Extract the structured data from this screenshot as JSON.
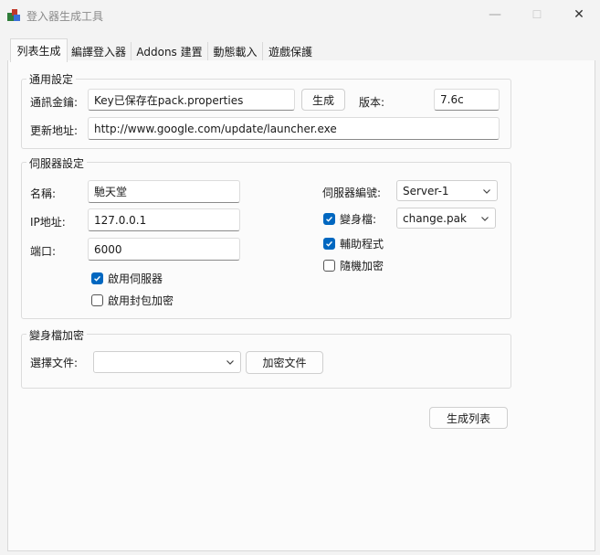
{
  "window": {
    "title": "登入器生成工具",
    "minimize_icon": "—",
    "maximize_icon": "☐",
    "close_icon": "✕"
  },
  "tabs": [
    {
      "label": "列表生成",
      "active": true
    },
    {
      "label": "編譯登入器"
    },
    {
      "label": "Addons 建置"
    },
    {
      "label": "動態載入"
    },
    {
      "label": "遊戲保護"
    }
  ],
  "general": {
    "title": "通用設定",
    "key_label": "通訊金鑰:",
    "key_value": "Key已保存在pack.properties",
    "generate_button": "生成",
    "version_label": "版本:",
    "version_value": "7.6c",
    "update_label": "更新地址:",
    "update_value": "http://www.google.com/update/launcher.exe"
  },
  "server": {
    "title": "伺服器設定",
    "name_label": "名稱:",
    "name_value": "馳天堂",
    "ip_label": "IP地址:",
    "ip_value": "127.0.0.1",
    "port_label": "端口:",
    "port_value": "6000",
    "enable_server_label": "啟用伺服器",
    "enable_server_checked": true,
    "enable_encrypt_label": "啟用封包加密",
    "enable_encrypt_checked": false,
    "server_no_label": "伺服器編號:",
    "server_no_value": "Server-1",
    "morph_label": "變身檔:",
    "morph_checked": true,
    "morph_value": "change.pak",
    "helper_label": "輔助程式",
    "helper_checked": true,
    "random_encrypt_label": "隨機加密",
    "random_encrypt_checked": false
  },
  "morph_encrypt": {
    "title": "變身檔加密",
    "file_label": "選擇文件:",
    "file_value": "",
    "encrypt_button": "加密文件"
  },
  "generate_list_button": "生成列表"
}
